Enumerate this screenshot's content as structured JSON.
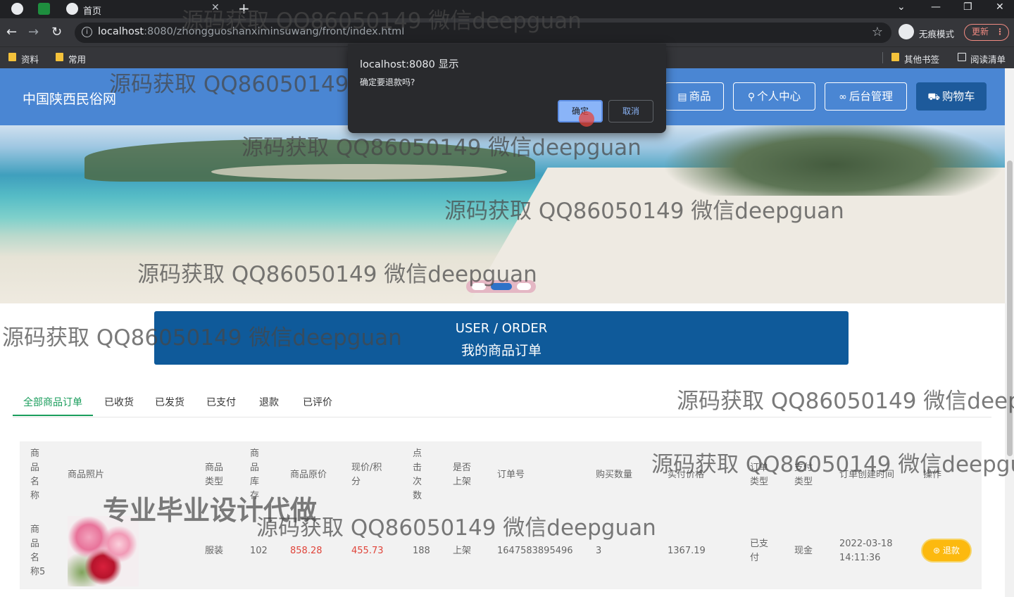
{
  "browser": {
    "tab_title": "首页",
    "url_host": "localhost",
    "url_path": ":8080/zhongguoshanximinsuwang/front/index.html",
    "incognito_label": "无痕模式",
    "update_label": "更新",
    "bookmarks": [
      "资料",
      "常用"
    ],
    "bookmarks_right": [
      "其他书签",
      "阅读清单"
    ]
  },
  "dialog": {
    "title": "localhost:8080 显示",
    "message": "确定要退款吗?",
    "ok_label": "确定",
    "cancel_label": "取消"
  },
  "site": {
    "title": "中国陕西民俗网",
    "nav": [
      {
        "label": "商品",
        "icon": "goods-icon"
      },
      {
        "label": "个人中心",
        "icon": "user-icon"
      },
      {
        "label": "后台管理",
        "icon": "link-icon"
      },
      {
        "label": "购物车",
        "icon": "cart-icon"
      }
    ]
  },
  "banner": {
    "slides": 3,
    "active_index": 1
  },
  "order_banner": {
    "en": "USER / ORDER",
    "cn": "我的商品订单"
  },
  "order_tabs": [
    "全部商品订单",
    "已收货",
    "已发货",
    "已支付",
    "退款",
    "已评价"
  ],
  "table": {
    "headers": [
      "商品名称",
      "商品照片",
      "商品类型",
      "商品库存",
      "商品原价",
      "现价/积分",
      "点击次数",
      "是否上架",
      "订单号",
      "购买数量",
      "实付价格",
      "订单类型",
      "支付类型",
      "订单创建时间",
      "操作"
    ],
    "rows": [
      {
        "name": "商品名称5",
        "type": "服装",
        "stock": "102",
        "original_price": "858.28",
        "price": "455.73",
        "clicks": "188",
        "on_shelf": "上架",
        "order_no": "1647583895496",
        "quantity": "3",
        "paid": "1367.19",
        "order_type": "已支付",
        "pay_type": "现金",
        "created_date": "2022-03-18",
        "created_time": "14:11:36",
        "action": "退款"
      }
    ]
  },
  "watermarks": {
    "text": "源码获取 QQ86050149 微信deepguan",
    "text_cut_a": "源码获取 QQ86050149 微信deepg",
    "text_cut_b": "源码获取 QQ86050149 微信deepgua",
    "big": "专业毕业设计代做"
  },
  "colors": {
    "header": "#4a86d3",
    "order_banner": "#0f5a9a",
    "tab_active": "#1a9d5c",
    "refund_button": "#fcb90f",
    "price_red": "#e0453b"
  }
}
